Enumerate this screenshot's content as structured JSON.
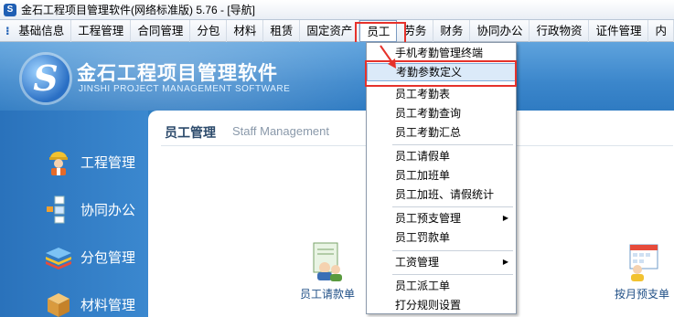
{
  "window": {
    "title": "金石工程项目管理软件(网络标准版) 5.76 - [导航]"
  },
  "menubar": {
    "items": [
      "基础信息",
      "工程管理",
      "合同管理",
      "分包",
      "材料",
      "租赁",
      "固定资产",
      "员工",
      "劳务",
      "财务",
      "协同办公",
      "行政物资",
      "证件管理",
      "内"
    ]
  },
  "banner": {
    "title": "金石工程项目管理软件",
    "subtitle": "JINSHI PROJECT MANAGEMENT SOFTWARE",
    "logo_letter": "S"
  },
  "leftnav": {
    "items": [
      {
        "label": "工程管理",
        "icon": "worker-icon"
      },
      {
        "label": "协同办公",
        "icon": "org-chart-icon"
      },
      {
        "label": "分包管理",
        "icon": "layers-icon"
      },
      {
        "label": "材料管理",
        "icon": "box-icon"
      }
    ]
  },
  "main": {
    "title": "员工管理",
    "title_en": "Staff Management",
    "tiles": [
      {
        "label": "员工请款单",
        "icon": "users-document-icon"
      },
      {
        "label": "按月预支单",
        "icon": "calendar-users-icon"
      }
    ]
  },
  "dropdown": {
    "items": [
      {
        "label": "手机考勤管理终端"
      },
      {
        "label": "考勤参数定义",
        "highlighted": true
      },
      {
        "label": "员工考勤表"
      },
      {
        "label": "员工考勤查询"
      },
      {
        "label": "员工考勤汇总"
      },
      {
        "label": "员工请假单"
      },
      {
        "label": "员工加班单"
      },
      {
        "label": "员工加班、请假统计"
      },
      {
        "label": "员工预支管理",
        "submenu": true
      },
      {
        "label": "员工罚款单"
      },
      {
        "label": "工资管理",
        "submenu": true
      },
      {
        "label": "员工派工单"
      },
      {
        "label": "打分规则设置"
      }
    ]
  },
  "colors": {
    "highlight_red": "#e6322b",
    "brand_blue": "#2f7fc4"
  }
}
